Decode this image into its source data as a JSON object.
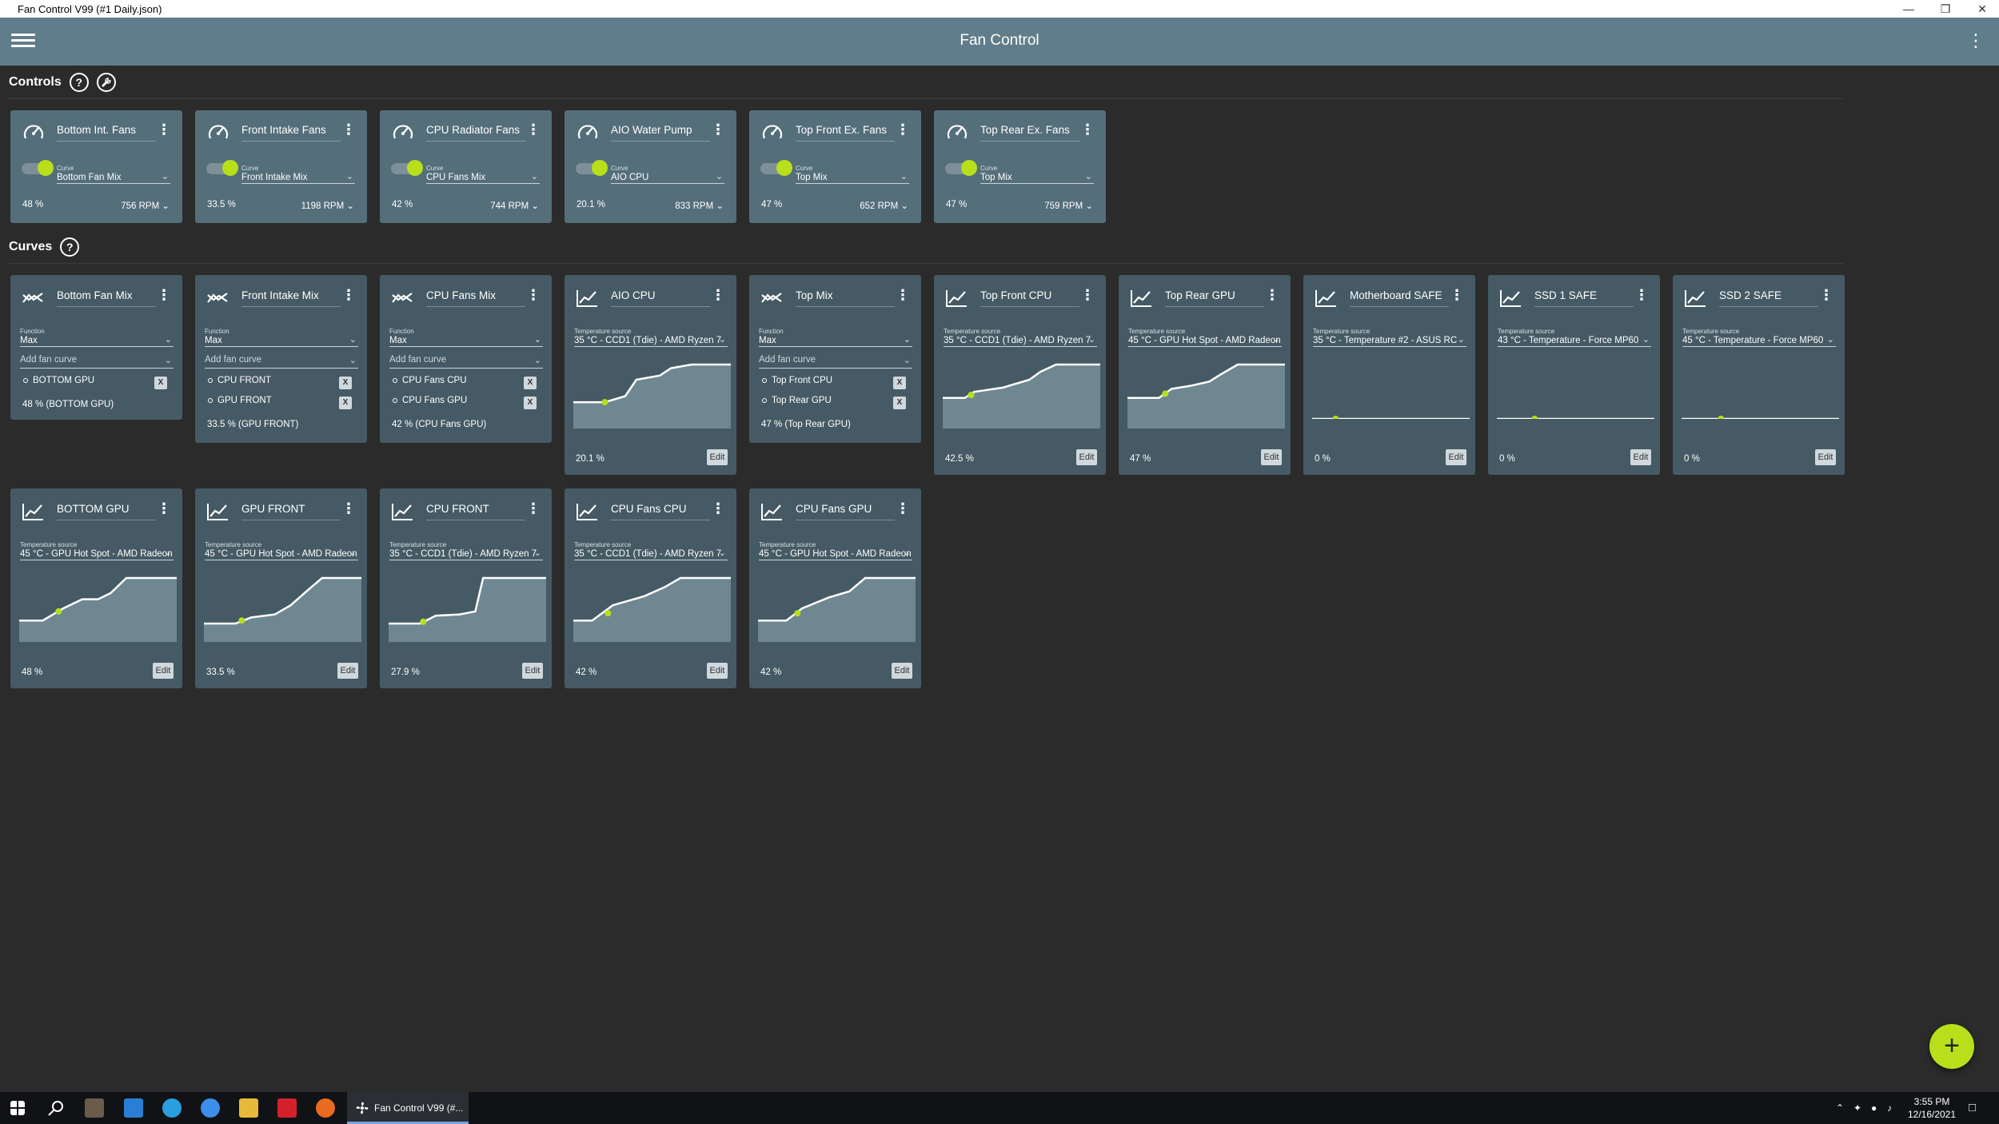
{
  "window": {
    "title": "Fan Control V99 (#1 Daily.json)"
  },
  "appbar": {
    "title": "Fan Control"
  },
  "sections": {
    "controls": "Controls",
    "curves": "Curves",
    "help": "?"
  },
  "colors": {
    "appbar": "#607d8b",
    "control_card": "#546e7a",
    "curve_card": "#455a64",
    "accent": "#b7e01a",
    "background": "#2b2b2b"
  },
  "common": {
    "curve_caption": "Curve",
    "function_caption": "Function",
    "temp_caption": "Temperature source",
    "add_fan_curve": "Add fan curve",
    "edit": "Edit",
    "remove": "X",
    "add": "+"
  },
  "controls": [
    {
      "name": "Bottom Int. Fans",
      "curve": "Bottom Fan Mix",
      "percent": "48 %",
      "rpm": "756 RPM",
      "enabled": true
    },
    {
      "name": "Front Intake Fans",
      "curve": "Front Intake Mix",
      "percent": "33.5 %",
      "rpm": "1198 RPM",
      "enabled": true
    },
    {
      "name": "CPU Radiator Fans",
      "curve": "CPU Fans Mix",
      "percent": "42 %",
      "rpm": "744 RPM",
      "enabled": true
    },
    {
      "name": "AIO Water Pump",
      "curve": "AIO CPU",
      "percent": "20.1 %",
      "rpm": "833 RPM",
      "enabled": true
    },
    {
      "name": "Top Front Ex. Fans",
      "curve": "Top Mix",
      "percent": "47 %",
      "rpm": "652 RPM",
      "enabled": true
    },
    {
      "name": "Top Rear Ex. Fans",
      "curve": "Top Mix",
      "percent": "47 %",
      "rpm": "759 RPM",
      "enabled": true
    }
  ],
  "mix_curves": [
    {
      "name": "Bottom Fan Mix",
      "function": "Max",
      "items": [
        "BOTTOM GPU"
      ],
      "result": "48 % (BOTTOM GPU)"
    },
    {
      "name": "Front Intake Mix",
      "function": "Max",
      "items": [
        "CPU FRONT",
        "GPU FRONT"
      ],
      "result": "33.5 % (GPU FRONT)"
    },
    {
      "name": "CPU Fans Mix",
      "function": "Max",
      "items": [
        "CPU Fans CPU",
        "CPU Fans GPU"
      ],
      "result": "42 % (CPU Fans GPU)"
    },
    {
      "name": "Top Mix",
      "function": "Max",
      "items": [
        "Top Front CPU",
        "Top Rear GPU"
      ],
      "result": "47 % (Top Rear GPU)"
    }
  ],
  "graph_curves": [
    {
      "name": "AIO CPU",
      "source": "35 °C - CCD1 (Tdie) - AMD Ryzen 7",
      "value": "20.1 %",
      "points": [
        [
          0,
          0.62
        ],
        [
          0.2,
          0.62
        ],
        [
          0.33,
          0.52
        ],
        [
          0.4,
          0.25
        ],
        [
          0.55,
          0.18
        ],
        [
          0.62,
          0.06
        ],
        [
          0.75,
          0
        ],
        [
          1,
          0
        ]
      ],
      "dot": [
        0.2,
        0.62
      ]
    },
    {
      "name": "Top Front CPU",
      "source": "35 °C - CCD1 (Tdie) - AMD Ryzen 7",
      "value": "42.5 %",
      "points": [
        [
          0,
          0.55
        ],
        [
          0.14,
          0.55
        ],
        [
          0.2,
          0.45
        ],
        [
          0.38,
          0.38
        ],
        [
          0.55,
          0.25
        ],
        [
          0.62,
          0.12
        ],
        [
          0.72,
          0
        ],
        [
          1,
          0
        ]
      ],
      "dot": [
        0.18,
        0.5
      ]
    },
    {
      "name": "Top Rear GPU",
      "source": "45 °C - GPU Hot Spot - AMD Radeon",
      "value": "47 %",
      "points": [
        [
          0,
          0.55
        ],
        [
          0.2,
          0.55
        ],
        [
          0.28,
          0.4
        ],
        [
          0.4,
          0.35
        ],
        [
          0.52,
          0.28
        ],
        [
          0.6,
          0.15
        ],
        [
          0.7,
          0
        ],
        [
          1,
          0
        ]
      ],
      "dot": [
        0.24,
        0.48
      ]
    },
    {
      "name": "Motherboard SAFE",
      "source": "35 °C - Temperature #2 - ASUS RC",
      "value": "0 %",
      "points": [
        [
          0,
          1
        ],
        [
          1,
          1
        ]
      ],
      "dot": [
        0.15,
        1
      ]
    },
    {
      "name": "SSD 1 SAFE",
      "source": "43 °C - Temperature - Force MP60",
      "value": "0 %",
      "points": [
        [
          0,
          1
        ],
        [
          1,
          1
        ]
      ],
      "dot": [
        0.24,
        1
      ]
    },
    {
      "name": "SSD 2 SAFE",
      "source": "45 °C - Temperature - Force MP60",
      "value": "0 %",
      "points": [
        [
          0,
          1
        ],
        [
          1,
          1
        ]
      ],
      "dot": [
        0.25,
        1
      ]
    },
    {
      "name": "BOTTOM GPU",
      "source": "45 °C - GPU Hot Spot - AMD Radeon",
      "value": "48 %",
      "points": [
        [
          0,
          0.7
        ],
        [
          0.15,
          0.7
        ],
        [
          0.28,
          0.5
        ],
        [
          0.4,
          0.35
        ],
        [
          0.5,
          0.35
        ],
        [
          0.58,
          0.25
        ],
        [
          0.68,
          0
        ],
        [
          1,
          0
        ]
      ],
      "dot": [
        0.25,
        0.55
      ]
    },
    {
      "name": "GPU FRONT",
      "source": "45 °C - GPU Hot Spot - AMD Radeon",
      "value": "33.5 %",
      "points": [
        [
          0,
          0.75
        ],
        [
          0.2,
          0.75
        ],
        [
          0.3,
          0.65
        ],
        [
          0.45,
          0.6
        ],
        [
          0.55,
          0.45
        ],
        [
          0.66,
          0.2
        ],
        [
          0.75,
          0
        ],
        [
          1,
          0
        ]
      ],
      "dot": [
        0.24,
        0.7
      ]
    },
    {
      "name": "CPU FRONT",
      "source": "35 °C - CCD1 (Tdie) - AMD Ryzen 7",
      "value": "27.9 %",
      "points": [
        [
          0,
          0.75
        ],
        [
          0.2,
          0.75
        ],
        [
          0.3,
          0.62
        ],
        [
          0.45,
          0.6
        ],
        [
          0.55,
          0.55
        ],
        [
          0.6,
          0
        ],
        [
          1,
          0
        ]
      ],
      "dot": [
        0.22,
        0.72
      ]
    },
    {
      "name": "CPU Fans CPU",
      "source": "35 °C - CCD1 (Tdie) - AMD Ryzen 7",
      "value": "42 %",
      "points": [
        [
          0,
          0.7
        ],
        [
          0.12,
          0.7
        ],
        [
          0.25,
          0.45
        ],
        [
          0.45,
          0.3
        ],
        [
          0.58,
          0.15
        ],
        [
          0.68,
          0
        ],
        [
          1,
          0
        ]
      ],
      "dot": [
        0.22,
        0.58
      ]
    },
    {
      "name": "CPU Fans GPU",
      "source": "45 °C - GPU Hot Spot - AMD Radeon",
      "value": "42 %",
      "points": [
        [
          0,
          0.7
        ],
        [
          0.18,
          0.7
        ],
        [
          0.28,
          0.5
        ],
        [
          0.45,
          0.32
        ],
        [
          0.58,
          0.22
        ],
        [
          0.68,
          0
        ],
        [
          1,
          0
        ]
      ],
      "dot": [
        0.25,
        0.58
      ]
    }
  ],
  "taskbar": {
    "active_app": "Fan Control V99 (#...",
    "time": "3:55 PM",
    "date": "12/16/2021"
  }
}
